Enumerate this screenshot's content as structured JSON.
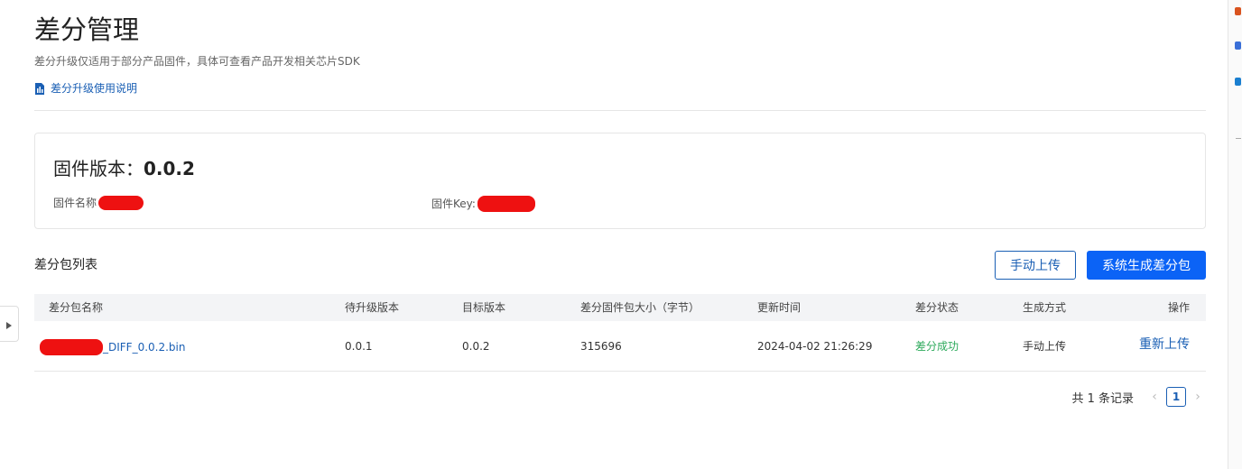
{
  "page": {
    "title": "差分管理",
    "subtitle": "差分升级仅适用于部分产品固件，具体可查看产品开发相关芯片SDK",
    "doc_link": "差分升级使用说明"
  },
  "firmware": {
    "version_label": "固件版本：",
    "version_value": "0.0.2",
    "name_label": "固件名称",
    "key_label": "固件Key:"
  },
  "list": {
    "title": "差分包列表",
    "manual_upload_button": "手动上传",
    "generate_button": "系统生成差分包",
    "columns": [
      "差分包名称",
      "待升级版本",
      "目标版本",
      "差分固件包大小（字节）",
      "更新时间",
      "差分状态",
      "生成方式",
      "操作"
    ],
    "rows": [
      {
        "name_suffix": "_DIFF_0.0.2.bin",
        "from_version": "0.0.1",
        "target_version": "0.0.2",
        "size": "315696",
        "updated": "2024-04-02 21:26:29",
        "status": "差分成功",
        "method": "手动上传",
        "action": "重新上传"
      }
    ]
  },
  "pagination": {
    "total_text": "共 1 条记录",
    "current_page": "1"
  },
  "colors": {
    "primary": "#0b63f6",
    "link": "#1a5fb4",
    "success": "#2eaa5c",
    "redaction": "#ee1111"
  },
  "icons": {
    "doc_link": "document-chart-icon",
    "prev": "chevron-left-icon",
    "next": "chevron-right-icon",
    "sidebar_toggle": "caret-right-icon"
  }
}
